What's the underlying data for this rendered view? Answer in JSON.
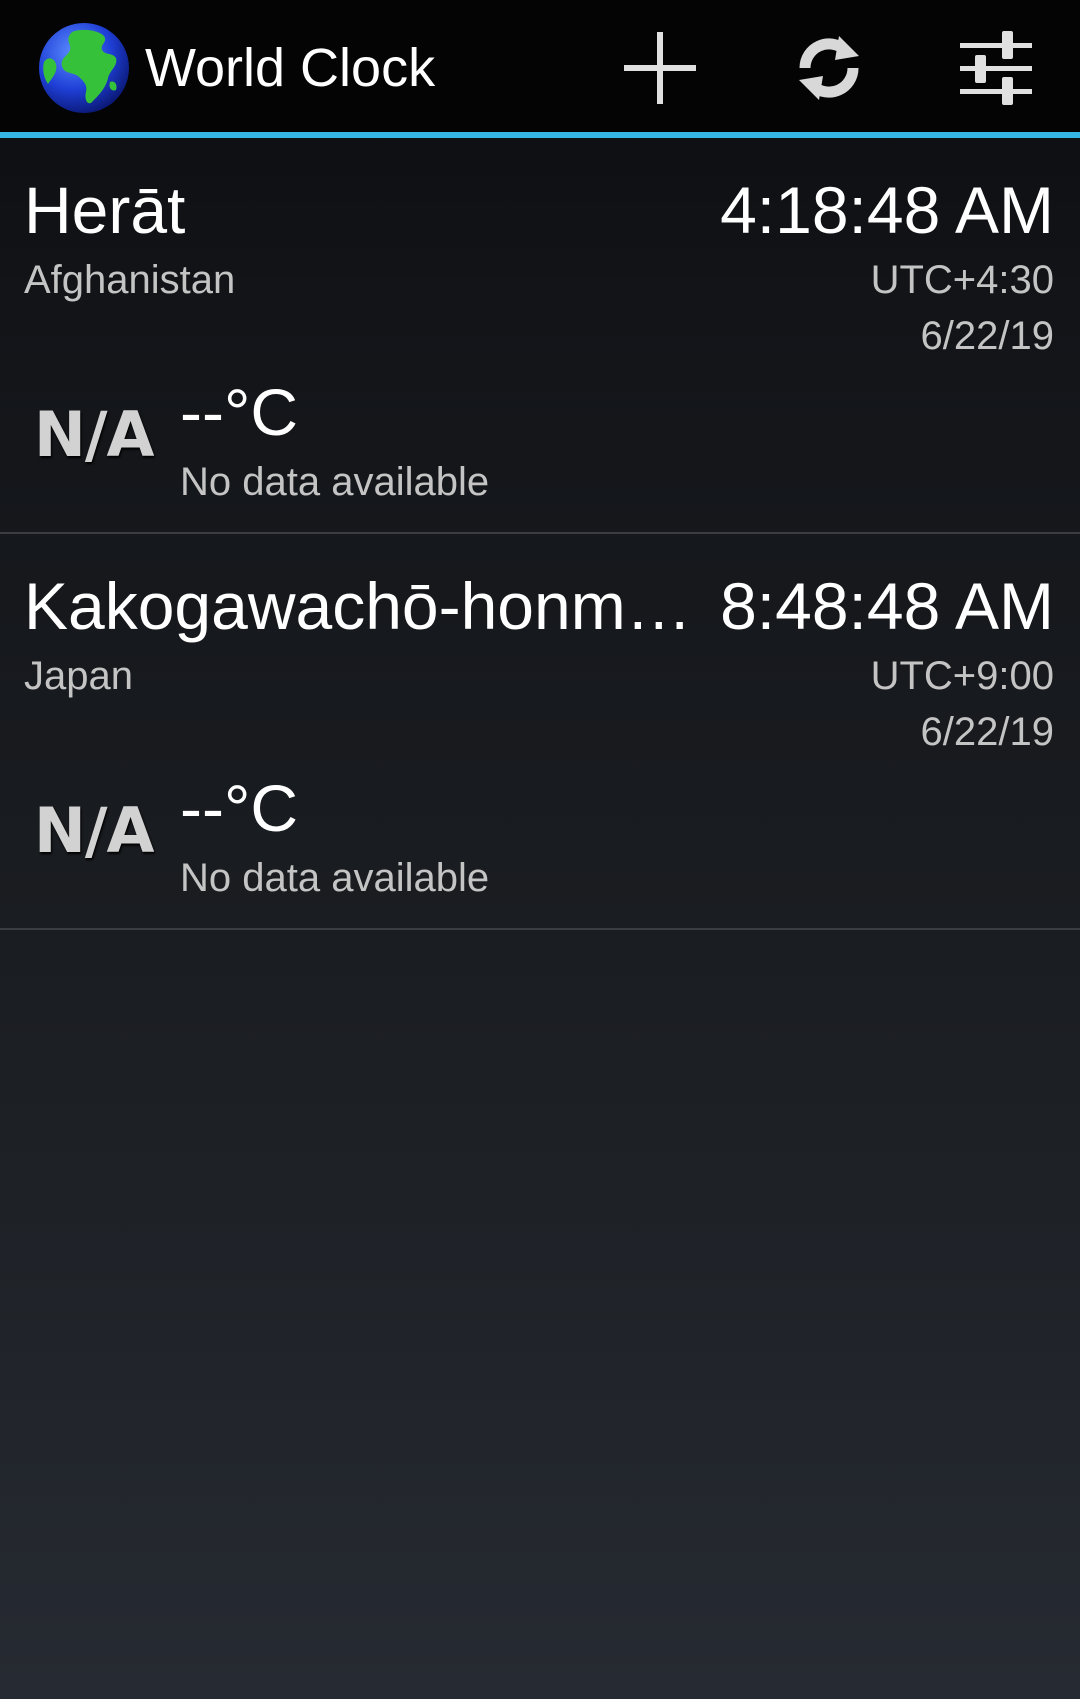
{
  "app": {
    "title": "World Clock",
    "icon": "globe-icon",
    "accent_color": "#33b5e5"
  },
  "actionbar": {
    "actions": [
      {
        "name": "add-city-button",
        "icon": "plus-icon"
      },
      {
        "name": "refresh-button",
        "icon": "refresh-icon"
      },
      {
        "name": "settings-button",
        "icon": "sliders-icon"
      }
    ]
  },
  "clocks": [
    {
      "city": "Herāt",
      "country": "Afghanistan",
      "time": "4:18:48 AM",
      "utc_offset": "UTC+4:30",
      "date": "6/22/19",
      "weather": {
        "icon_text": "N/A",
        "temperature": "--°C",
        "description": "No data available"
      }
    },
    {
      "city": "Kakogawachō-honmachi",
      "country": "Japan",
      "time": "8:48:48 AM",
      "utc_offset": "UTC+9:00",
      "date": "6/22/19",
      "weather": {
        "icon_text": "N/A",
        "temperature": "--°C",
        "description": "No data available"
      }
    }
  ]
}
